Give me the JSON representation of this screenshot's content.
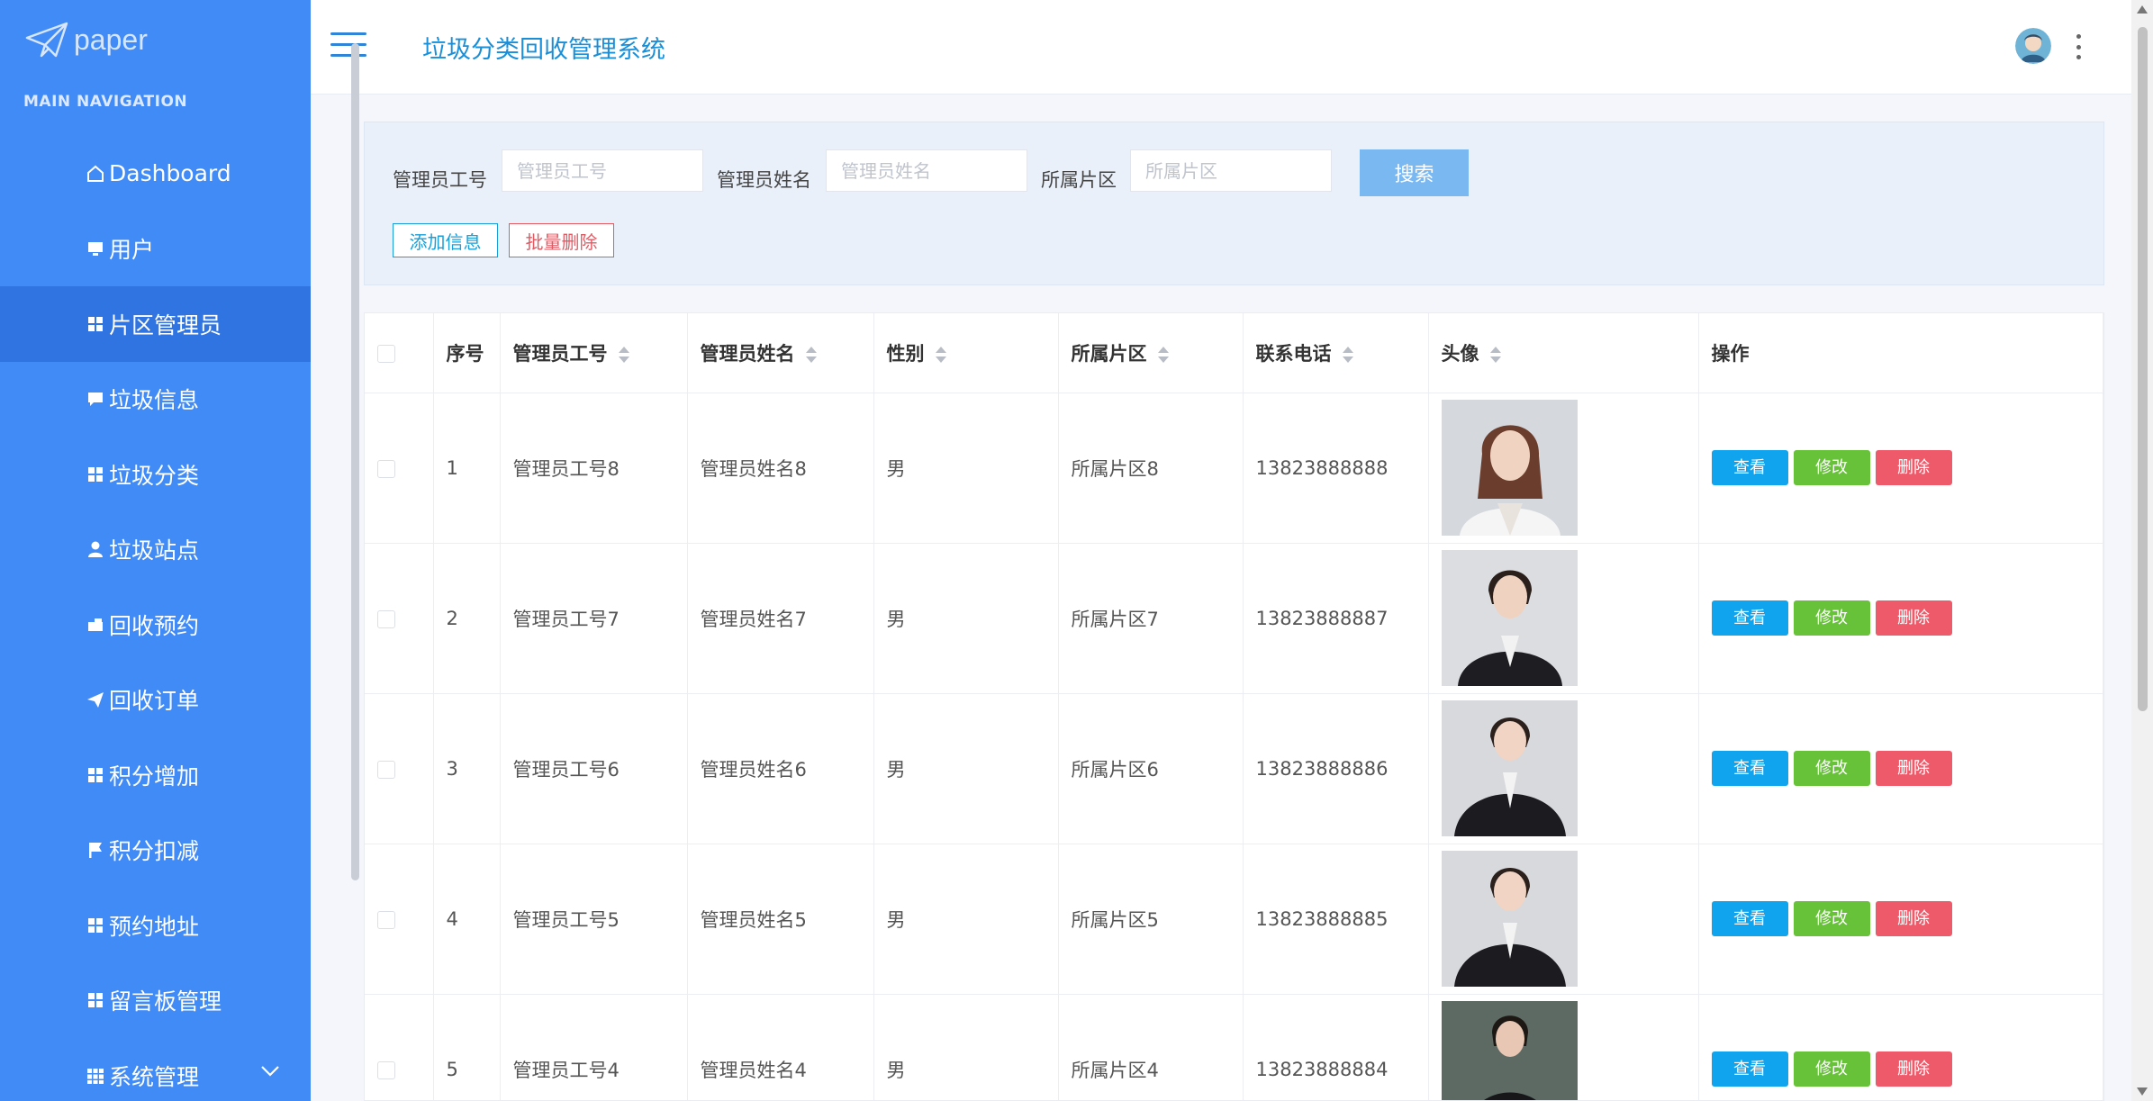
{
  "app": {
    "logo_text": "paper",
    "nav_section": "MAIN NAVIGATION",
    "system_title": "垃圾分类回收管理系统"
  },
  "sidebar": {
    "items": [
      {
        "label": "Dashboard",
        "icon": "home-icon",
        "active": false
      },
      {
        "label": "用户",
        "icon": "monitor-icon",
        "active": false
      },
      {
        "label": "片区管理员",
        "icon": "grid-icon",
        "active": true
      },
      {
        "label": "垃圾信息",
        "icon": "comment-icon",
        "active": false
      },
      {
        "label": "垃圾分类",
        "icon": "grid-icon",
        "active": false
      },
      {
        "label": "垃圾站点",
        "icon": "user-icon",
        "active": false
      },
      {
        "label": "回收预约",
        "icon": "bus-icon",
        "active": false
      },
      {
        "label": "回收订单",
        "icon": "send-icon",
        "active": false
      },
      {
        "label": "积分增加",
        "icon": "grid-icon",
        "active": false
      },
      {
        "label": "积分扣减",
        "icon": "flag-icon",
        "active": false
      },
      {
        "label": "预约地址",
        "icon": "grid-icon",
        "active": false
      },
      {
        "label": "留言板管理",
        "icon": "grid-icon",
        "active": false
      },
      {
        "label": "系统管理",
        "icon": "grid-icon",
        "active": false
      }
    ]
  },
  "search": {
    "field1_label": "管理员工号",
    "field1_placeholder": "管理员工号",
    "field2_label": "管理员姓名",
    "field2_placeholder": "管理员姓名",
    "field3_label": "所属片区",
    "field3_placeholder": "所属片区",
    "search_button": "搜索",
    "add_button": "添加信息",
    "batch_delete_button": "批量删除"
  },
  "table": {
    "headers": {
      "index": "序号",
      "admin_no": "管理员工号",
      "admin_name": "管理员姓名",
      "gender": "性别",
      "area": "所属片区",
      "phone": "联系电话",
      "avatar": "头像",
      "actions": "操作"
    },
    "action_labels": {
      "view": "查看",
      "edit": "修改",
      "delete": "删除"
    },
    "rows": [
      {
        "index": "1",
        "admin_no": "管理员工号8",
        "admin_name": "管理员姓名8",
        "gender": "男",
        "area": "所属片区8",
        "phone": "13823888888"
      },
      {
        "index": "2",
        "admin_no": "管理员工号7",
        "admin_name": "管理员姓名7",
        "gender": "男",
        "area": "所属片区7",
        "phone": "13823888887"
      },
      {
        "index": "3",
        "admin_no": "管理员工号6",
        "admin_name": "管理员姓名6",
        "gender": "男",
        "area": "所属片区6",
        "phone": "13823888886"
      },
      {
        "index": "4",
        "admin_no": "管理员工号5",
        "admin_name": "管理员姓名5",
        "gender": "男",
        "area": "所属片区5",
        "phone": "13823888885"
      },
      {
        "index": "5",
        "admin_no": "管理员工号4",
        "admin_name": "管理员姓名4",
        "gender": "男",
        "area": "所属片区4",
        "phone": "13823888884"
      }
    ]
  },
  "colors": {
    "sidebar_bg": "#418bf7",
    "sidebar_active": "#2f74e0",
    "title_blue": "#1a8fd8",
    "view_btn": "#11a4ee",
    "edit_btn": "#67c23a",
    "delete_btn": "#ee5a6a"
  }
}
